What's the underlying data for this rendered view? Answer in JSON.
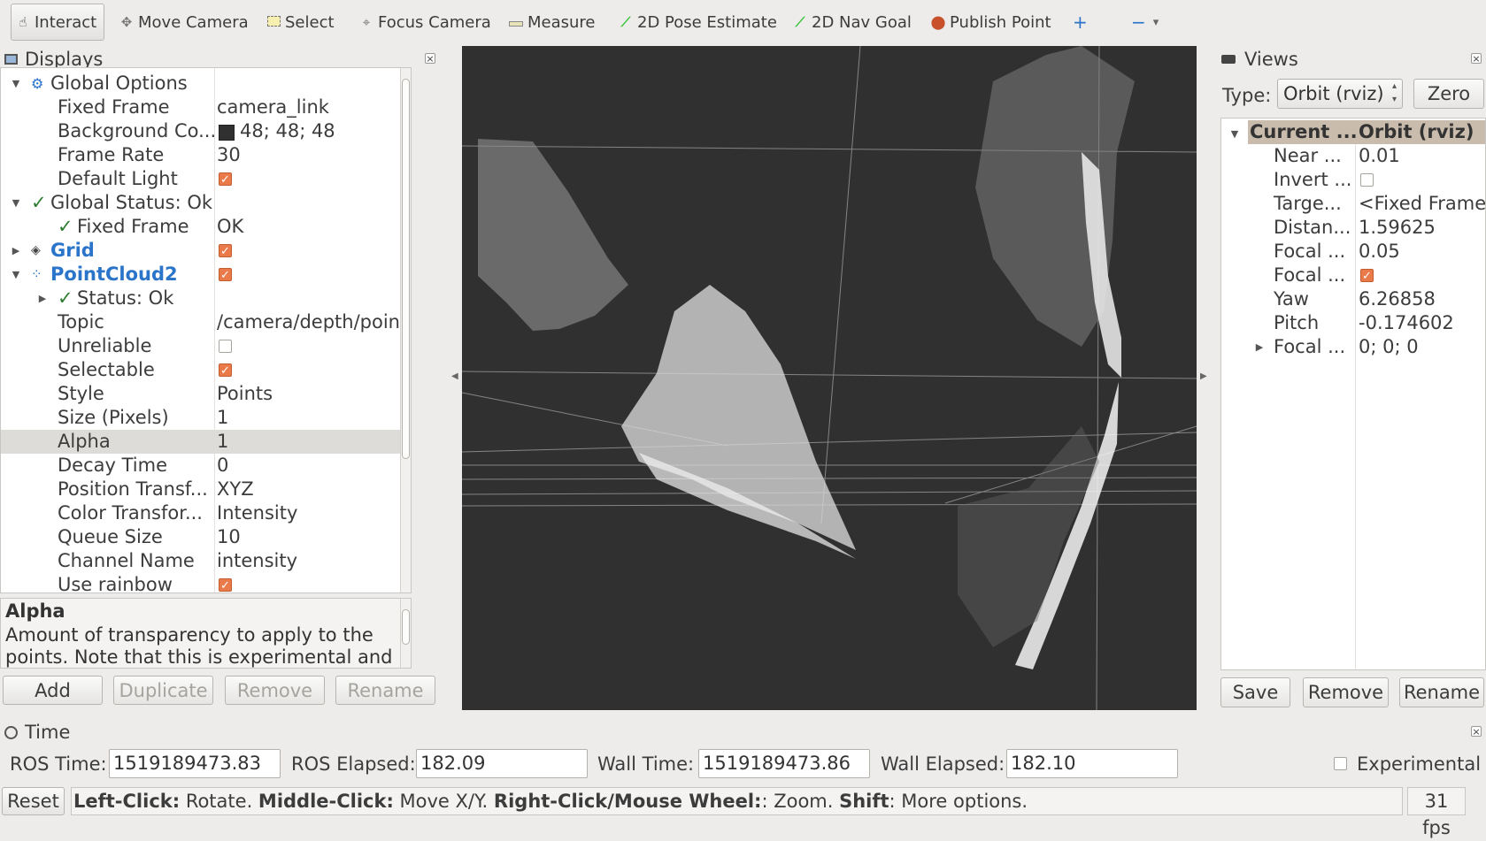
{
  "toolbar": {
    "tools": [
      {
        "label": "Interact",
        "icon": "hand-icon"
      },
      {
        "label": "Move Camera",
        "icon": "move-camera-icon"
      },
      {
        "label": "Select",
        "icon": "select-icon"
      },
      {
        "label": "Focus Camera",
        "icon": "focus-camera-icon"
      },
      {
        "label": "Measure",
        "icon": "measure-icon"
      },
      {
        "label": "2D Pose Estimate",
        "icon": "pose-arrow-icon"
      },
      {
        "label": "2D Nav Goal",
        "icon": "nav-arrow-icon"
      },
      {
        "label": "Publish Point",
        "icon": "pin-icon"
      }
    ],
    "add_icon": "+",
    "remove_icon": "−",
    "menu_icon": "▾"
  },
  "displays": {
    "title": "Displays",
    "rows": [
      {
        "label": "Global Options",
        "value": ""
      },
      {
        "label": "Fixed Frame",
        "value": "camera_link"
      },
      {
        "label": "Background Co...",
        "value": "48; 48; 48"
      },
      {
        "label": "Frame Rate",
        "value": "30"
      },
      {
        "label": "Default Light",
        "value": ""
      },
      {
        "label": "Global Status: Ok",
        "value": ""
      },
      {
        "label": "Fixed Frame",
        "value": "OK"
      },
      {
        "label": "Grid",
        "value": ""
      },
      {
        "label": "PointCloud2",
        "value": ""
      },
      {
        "label": "Status: Ok",
        "value": ""
      },
      {
        "label": "Topic",
        "value": "/camera/depth/points"
      },
      {
        "label": "Unreliable",
        "value": ""
      },
      {
        "label": "Selectable",
        "value": ""
      },
      {
        "label": "Style",
        "value": "Points"
      },
      {
        "label": "Size (Pixels)",
        "value": "1"
      },
      {
        "label": "Alpha",
        "value": "1"
      },
      {
        "label": "Decay Time",
        "value": "0"
      },
      {
        "label": "Position Transf...",
        "value": "XYZ"
      },
      {
        "label": "Color Transfor...",
        "value": "Intensity"
      },
      {
        "label": "Queue Size",
        "value": "10"
      },
      {
        "label": "Channel Name",
        "value": "intensity"
      },
      {
        "label": "Use rainbow",
        "value": ""
      }
    ],
    "description_title": "Alpha",
    "description_body": "Amount of transparency to apply to the points. Note that this is experimental and does not",
    "buttons": {
      "add": "Add",
      "duplicate": "Duplicate",
      "remove": "Remove",
      "rename": "Rename"
    }
  },
  "views": {
    "title": "Views",
    "type_label": "Type:",
    "type_value": "Orbit (rviz)",
    "zero_label": "Zero",
    "header_label": "Current ...",
    "header_value": "Orbit (rviz)",
    "rows": [
      {
        "label": "Near ...",
        "value": "0.01"
      },
      {
        "label": "Invert ...",
        "value": ""
      },
      {
        "label": "Targe...",
        "value": "<Fixed Frame>"
      },
      {
        "label": "Distan...",
        "value": "1.59625"
      },
      {
        "label": "Focal ...",
        "value": "0.05"
      },
      {
        "label": "Focal ...",
        "value": ""
      },
      {
        "label": "Yaw",
        "value": "6.26858"
      },
      {
        "label": "Pitch",
        "value": "-0.174602"
      },
      {
        "label": "Focal ...",
        "value": "0; 0; 0"
      }
    ],
    "buttons": {
      "save": "Save",
      "remove": "Remove",
      "rename": "Rename"
    }
  },
  "time": {
    "title": "Time",
    "ros_time_label": "ROS Time:",
    "ros_time": "1519189473.83",
    "ros_elapsed_label": "ROS Elapsed:",
    "ros_elapsed": "182.09",
    "wall_time_label": "Wall Time:",
    "wall_time": "1519189473.86",
    "wall_elapsed_label": "Wall Elapsed:",
    "wall_elapsed": "182.10",
    "experimental_label": "Experimental"
  },
  "status": {
    "reset_label": "Reset",
    "hint_b1": "Left-Click:",
    "hint_t1": " Rotate. ",
    "hint_b2": "Middle-Click:",
    "hint_t2": " Move X/Y. ",
    "hint_b3": "Right-Click/Mouse Wheel:",
    "hint_t3": ": Zoom. ",
    "hint_b4": "Shift",
    "hint_t4": ": More options.",
    "fps": "31 fps"
  },
  "colors": {
    "viewport_bg": "#303030",
    "background_swatch": "#303030",
    "checkbox_on": "#ea7a4a",
    "link_blue": "#2a74c9",
    "views_header": "#c9bcac"
  }
}
